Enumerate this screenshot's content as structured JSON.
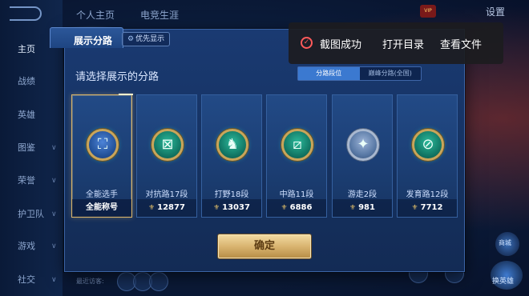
{
  "background": {
    "nav_items": [
      {
        "label": "主页",
        "active": true
      },
      {
        "label": "战绩"
      },
      {
        "label": "英雄"
      },
      {
        "label": "图鉴"
      },
      {
        "label": "荣誉"
      },
      {
        "label": "护卫队"
      },
      {
        "label": "游戏"
      },
      {
        "label": "社交"
      }
    ],
    "top_tabs": [
      "个人主页",
      "电竞生涯"
    ],
    "settings_label": "设置",
    "vip_badge": "VIP",
    "bottom_hint": "最近访客:",
    "right_label_1": "商城",
    "right_label_2": "换英雄"
  },
  "modal": {
    "title": "展示分路",
    "priority_chip": "优先显示",
    "section_title": "请选择展示的分路",
    "segments": [
      {
        "label": "分路段位",
        "selected": true
      },
      {
        "label": "巅峰分路(全国)",
        "selected": false
      }
    ],
    "cards": [
      {
        "name": "全能选手",
        "footer": "全能称号",
        "selected": true,
        "emblem": "blue",
        "glyph": "⛶",
        "show_trophy": false
      },
      {
        "name": "对抗路17段",
        "footer": "12877",
        "selected": false,
        "emblem": "teal",
        "glyph": "⊠",
        "show_trophy": true
      },
      {
        "name": "打野18段",
        "footer": "13037",
        "selected": false,
        "emblem": "teal",
        "glyph": "♞",
        "show_trophy": true
      },
      {
        "name": "中路11段",
        "footer": "6886",
        "selected": false,
        "emblem": "teal",
        "glyph": "⧄",
        "show_trophy": true
      },
      {
        "name": "游走2段",
        "footer": "981",
        "selected": false,
        "emblem": "silver",
        "glyph": "✦",
        "show_trophy": true
      },
      {
        "name": "发育路12段",
        "footer": "7712",
        "selected": false,
        "emblem": "teal",
        "glyph": "⊘",
        "show_trophy": true
      }
    ],
    "confirm_label": "确定"
  },
  "toast": {
    "message": "截图成功",
    "actions": [
      "打开目录",
      "查看文件"
    ]
  }
}
